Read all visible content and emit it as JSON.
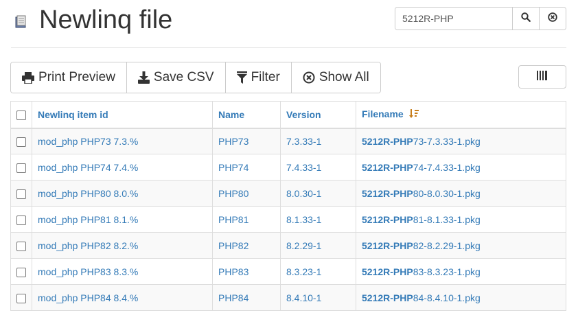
{
  "header": {
    "title": "Newlinq file",
    "app_icon": "document-icon"
  },
  "search": {
    "value": "5212R-PHP",
    "search_icon": "search-icon",
    "clear_icon": "clear-circle-icon"
  },
  "toolbar": {
    "print_label": "Print Preview",
    "save_csv_label": "Save CSV",
    "filter_label": "Filter",
    "show_all_label": "Show All",
    "columns_icon": "columns-icon"
  },
  "table": {
    "headers": {
      "item_id": "Newlinq item id",
      "name": "Name",
      "version": "Version",
      "filename": "Filename"
    },
    "sort_icon": "sort-desc-icon",
    "rows": [
      {
        "item_id": "mod_php PHP73 7.3.%",
        "name": "PHP73",
        "version": "7.3.33-1",
        "filename_match": "5212R-PHP",
        "filename_rest": "73-7.3.33-1.pkg"
      },
      {
        "item_id": "mod_php PHP74 7.4.%",
        "name": "PHP74",
        "version": "7.4.33-1",
        "filename_match": "5212R-PHP",
        "filename_rest": "74-7.4.33-1.pkg"
      },
      {
        "item_id": "mod_php PHP80 8.0.%",
        "name": "PHP80",
        "version": "8.0.30-1",
        "filename_match": "5212R-PHP",
        "filename_rest": "80-8.0.30-1.pkg"
      },
      {
        "item_id": "mod_php PHP81 8.1.%",
        "name": "PHP81",
        "version": "8.1.33-1",
        "filename_match": "5212R-PHP",
        "filename_rest": "81-8.1.33-1.pkg"
      },
      {
        "item_id": "mod_php PHP82 8.2.%",
        "name": "PHP82",
        "version": "8.2.29-1",
        "filename_match": "5212R-PHP",
        "filename_rest": "82-8.2.29-1.pkg"
      },
      {
        "item_id": "mod_php PHP83 8.3.%",
        "name": "PHP83",
        "version": "8.3.23-1",
        "filename_match": "5212R-PHP",
        "filename_rest": "83-8.3.23-1.pkg"
      },
      {
        "item_id": "mod_php PHP84 8.4.%",
        "name": "PHP84",
        "version": "8.4.10-1",
        "filename_match": "5212R-PHP",
        "filename_rest": "84-8.4.10-1.pkg"
      }
    ]
  },
  "colors": {
    "link": "#337ab7",
    "text": "#333333",
    "sort_icon": "#c77d1a"
  }
}
